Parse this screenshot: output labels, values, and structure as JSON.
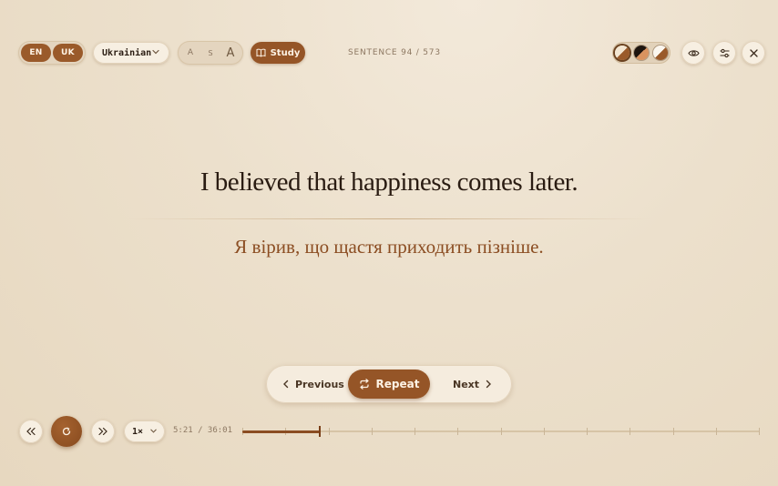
{
  "topbar": {
    "lang_en": "EN",
    "lang_uk": "UK",
    "language_select": "Ukrainian",
    "font_size": {
      "small_a": "A",
      "s": "S",
      "large_a": "A"
    },
    "study_label": "Study",
    "counter": "SENTENCE 94 / 573"
  },
  "theme_swatches": [
    "cream-brown",
    "dark-amber",
    "light-brown"
  ],
  "sentence": {
    "english": "I believed that happiness comes later.",
    "translation": "Я вірив, що щастя приходить пізніше."
  },
  "nav": {
    "previous_label": "Previous",
    "repeat_label": "Repeat",
    "next_label": "Next"
  },
  "player": {
    "speed": "1×",
    "time": "5:21 / 36:01",
    "progress_fraction": 0.149,
    "tick_count": 13
  },
  "colors": {
    "accent": "#955527",
    "translation_text": "#8b4d22",
    "background": "#ece0cc"
  },
  "icons": {
    "study": "book-icon",
    "eye": "eye-icon",
    "settings": "sliders-icon",
    "close": "close-icon",
    "repeat": "repeat-icon",
    "play": "rotate-cw-icon",
    "rewind": "double-chevron-left-icon",
    "forward": "double-chevron-right-icon"
  }
}
